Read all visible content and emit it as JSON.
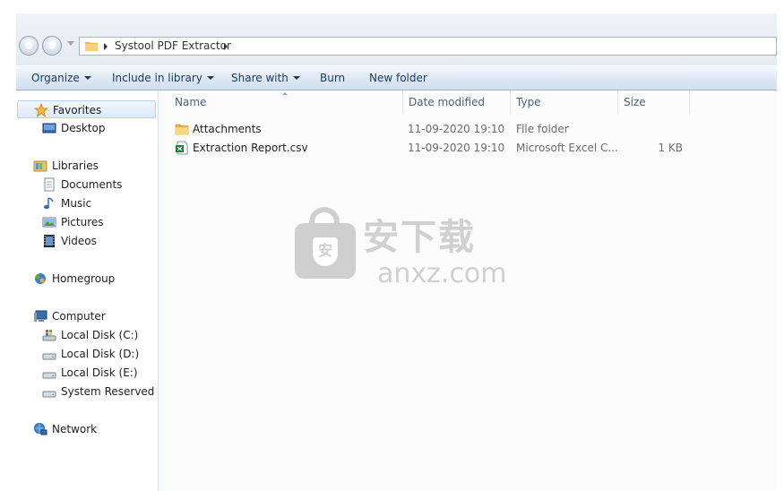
{
  "address_bar": {
    "path": [
      "Systool PDF Extractor"
    ]
  },
  "toolbar": {
    "organize": "Organize",
    "include_in_library": "Include in library",
    "share_with": "Share with",
    "burn": "Burn",
    "new_folder": "New folder"
  },
  "nav": {
    "favorites": "Favorites",
    "desktop": "Desktop",
    "libraries": "Libraries",
    "documents": "Documents",
    "music": "Music",
    "pictures": "Pictures",
    "videos": "Videos",
    "homegroup": "Homegroup",
    "computer": "Computer",
    "disk_c": "Local Disk (C:)",
    "disk_d": "Local Disk (D:)",
    "disk_e": "Local Disk (E:)",
    "system_reserved": "System Reserved (H:",
    "network": "Network"
  },
  "columns": {
    "name": "Name",
    "date_modified": "Date modified",
    "type": "Type",
    "size": "Size"
  },
  "files": [
    {
      "name": "Attachments",
      "date": "11-09-2020 19:10",
      "type": "File folder",
      "size": "",
      "icon": "folder-icon"
    },
    {
      "name": "Extraction Report.csv",
      "date": "11-09-2020 19:10",
      "type": "Microsoft Excel C...",
      "size": "1 KB",
      "icon": "excel-csv-icon"
    }
  ],
  "watermark": {
    "cn": "安下载",
    "en": "anxz.com",
    "badge": "安"
  }
}
